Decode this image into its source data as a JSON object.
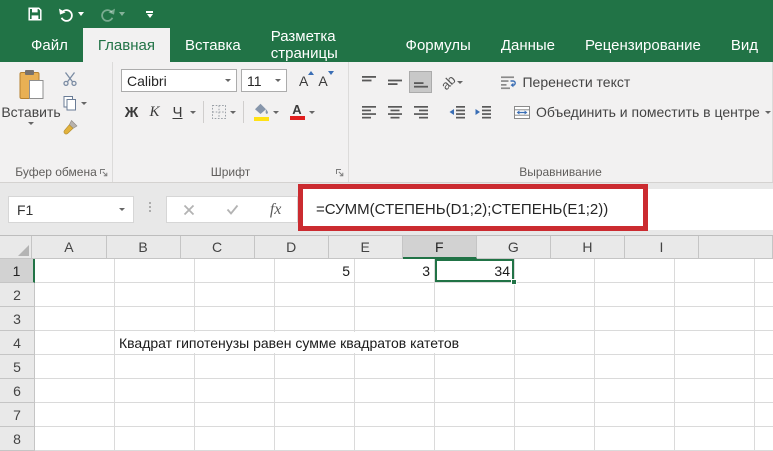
{
  "colors": {
    "excel_green": "#217346",
    "annotation_red": "#cb2b30",
    "fill_yellow": "#ffe115",
    "font_color_red": "#e01e1e",
    "blue_accent": "#3a6eb5"
  },
  "tabs": [
    {
      "label": "Файл",
      "kind": "file"
    },
    {
      "label": "Главная",
      "active": true
    },
    {
      "label": "Вставка"
    },
    {
      "label": "Разметка страницы"
    },
    {
      "label": "Формулы"
    },
    {
      "label": "Данные"
    },
    {
      "label": "Рецензирование"
    },
    {
      "label": "Вид"
    }
  ],
  "ribbon": {
    "clipboard": {
      "paste_label": "Вставить",
      "group_label": "Буфер обмена"
    },
    "font": {
      "font_name": "Calibri",
      "font_size": "11",
      "bold_label": "Ж",
      "italic_label": "К",
      "underline_label": "Ч",
      "grow_letter": "A",
      "shrink_letter": "A",
      "color_letter": "А",
      "orientation_letters": "ab",
      "group_label": "Шрифт"
    },
    "alignment": {
      "wrap_label": "Перенести текст",
      "merge_label": "Объединить и поместить в центре",
      "group_label": "Выравнивание"
    }
  },
  "formula_bar": {
    "name_box": "F1",
    "fx_label": "fx",
    "formula": "=СУММ(СТЕПЕНЬ(D1;2);СТЕПЕНЬ(E1;2))"
  },
  "grid": {
    "columns": [
      "A",
      "B",
      "C",
      "D",
      "E",
      "F",
      "G",
      "H",
      "I"
    ],
    "rows": [
      "1",
      "2",
      "3",
      "4",
      "5",
      "6",
      "7",
      "8"
    ],
    "selected": {
      "col": "F",
      "row": "1"
    },
    "cells": [
      {
        "col": "D",
        "row": "1",
        "value": "5"
      },
      {
        "col": "E",
        "row": "1",
        "value": "3"
      },
      {
        "col": "F",
        "row": "1",
        "value": "34"
      }
    ],
    "overflow_text": {
      "col": "B",
      "row": "4",
      "value": "Квадрат гипотенузы равен сумме квадратов катетов"
    }
  }
}
